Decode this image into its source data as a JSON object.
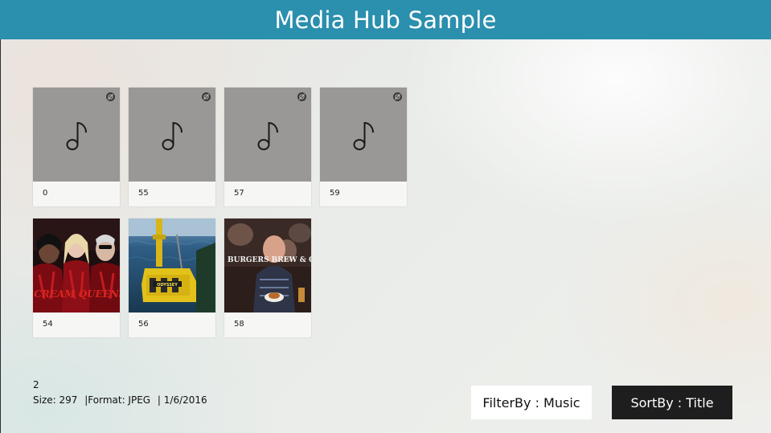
{
  "header": {
    "title": "Media Hub Sample"
  },
  "tiles": [
    {
      "label": "0",
      "type": "music",
      "icon": "music-note-icon",
      "badge": "no-image-badge-icon"
    },
    {
      "label": "55",
      "type": "music",
      "icon": "music-note-icon",
      "badge": "no-image-badge-icon"
    },
    {
      "label": "57",
      "type": "music",
      "icon": "music-note-icon",
      "badge": "no-image-badge-icon"
    },
    {
      "label": "59",
      "type": "music",
      "icon": "music-note-icon",
      "badge": "no-image-badge-icon"
    },
    {
      "label": "54",
      "type": "image",
      "image_text": "SCREAM QUEENS"
    },
    {
      "label": "56",
      "type": "image",
      "image_text": "ODYSSEY"
    },
    {
      "label": "58",
      "type": "image",
      "image_text": "BURGERS BREW & QUE"
    }
  ],
  "info": {
    "count": "2",
    "size": "Size: 297",
    "format": "|Format: JPEG",
    "date": "|  1/6/2016"
  },
  "buttons": {
    "filter_label": "FilterBy : Music",
    "sort_label": "SortBy : Title"
  },
  "colors": {
    "header": "#2b8fae",
    "music_tile": "#9a9896",
    "sort_button": "#1e1e1e",
    "filter_button": "#ffffff"
  }
}
